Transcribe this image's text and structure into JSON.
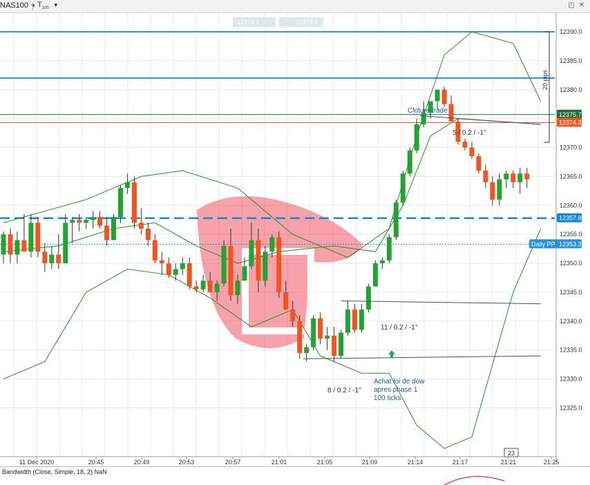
{
  "toolbar": {
    "symbol": "NAS100",
    "timeframe": "T",
    "timeframe_sub": "100",
    "icons": [
      "chevron-down-icon",
      "maximize-icon",
      "close-icon"
    ]
  },
  "crosshair_labels": {
    "left": "12374.x",
    "right": "12375.x"
  },
  "price_axis": {
    "ticks": [
      "12390.0",
      "12385.0",
      "12380.0",
      "12375.0",
      "12370.0",
      "12365.0",
      "12360.0",
      "12355.0",
      "12350.0",
      "12345.0",
      "12340.0",
      "12335.0",
      "12330.0",
      "12325.0"
    ],
    "tags": {
      "ask": "12375.7",
      "bid": "12374.3",
      "pivot": "12357.8",
      "daily_pp_name": "Daily PP",
      "daily_pp": "12353.3"
    },
    "pips_label": "20 pips"
  },
  "time_axis": {
    "ticks": [
      "11 Dec 2020",
      "20:45",
      "20:49",
      "20:53",
      "20:57",
      "21:01",
      "21:05",
      "21:09",
      "21:14",
      "21:17",
      "21:21",
      "21:25"
    ],
    "marker": "23"
  },
  "annotations": {
    "cloture": "Cloture trade",
    "ratio_top": "5 / 0.2 / -1°",
    "ratio_mid": "11 / 0.2 / -1°",
    "ratio_bottom": "8 / 0.2 / -1°",
    "achat_line1": "Achat loi de dow",
    "achat_line2": "apres phase 1",
    "achat_line3": "100 ticks"
  },
  "indicator": {
    "label": "Bandwidth (Close, Simple, 18, 2) NaN"
  },
  "colors": {
    "bull": "#22a333",
    "bear": "#ee5522",
    "bollinger": "#2a8a2a",
    "hline": "#1188dd",
    "ask": "#1e6e2e",
    "bid": "#ee5522",
    "pivot": "#1188dd",
    "annotation_text": "#1a5c8c"
  },
  "chart_data": {
    "type": "candlestick",
    "symbol": "NAS100",
    "y_range": [
      12322,
      12393
    ],
    "bollinger_bands": {
      "period": 18,
      "deviations": 2
    },
    "candles": [
      {
        "o": 12351.5,
        "h": 12355.5,
        "l": 12350.0,
        "c": 12355.0
      },
      {
        "o": 12355.0,
        "h": 12356.0,
        "l": 12350.0,
        "c": 12351.5
      },
      {
        "o": 12351.5,
        "h": 12355.5,
        "l": 12350.0,
        "c": 12354.0
      },
      {
        "o": 12354.0,
        "h": 12358.5,
        "l": 12352.0,
        "c": 12352.0
      },
      {
        "o": 12352.0,
        "h": 12358.5,
        "l": 12351.0,
        "c": 12357.0
      },
      {
        "o": 12357.0,
        "h": 12358.0,
        "l": 12351.0,
        "c": 12352.0
      },
      {
        "o": 12352.0,
        "h": 12353.5,
        "l": 12348.5,
        "c": 12350.0
      },
      {
        "o": 12350.0,
        "h": 12353.0,
        "l": 12349.0,
        "c": 12351.5
      },
      {
        "o": 12351.5,
        "h": 12355.0,
        "l": 12349.0,
        "c": 12350.0
      },
      {
        "o": 12350.0,
        "h": 12358.5,
        "l": 12350.0,
        "c": 12357.0
      },
      {
        "o": 12357.0,
        "h": 12358.0,
        "l": 12353.5,
        "c": 12357.5
      },
      {
        "o": 12357.5,
        "h": 12358.5,
        "l": 12355.5,
        "c": 12357.0
      },
      {
        "o": 12357.0,
        "h": 12358.0,
        "l": 12356.0,
        "c": 12357.5
      },
      {
        "o": 12357.5,
        "h": 12359.0,
        "l": 12356.0,
        "c": 12358.0
      },
      {
        "o": 12358.0,
        "h": 12359.0,
        "l": 12356.0,
        "c": 12356.5
      },
      {
        "o": 12356.5,
        "h": 12358.0,
        "l": 12353.0,
        "c": 12354.0
      },
      {
        "o": 12354.0,
        "h": 12358.5,
        "l": 12354.0,
        "c": 12358.0
      },
      {
        "o": 12358.0,
        "h": 12363.5,
        "l": 12357.0,
        "c": 12363.0
      },
      {
        "o": 12363.0,
        "h": 12365.5,
        "l": 12362.0,
        "c": 12364.0
      },
      {
        "o": 12364.0,
        "h": 12365.0,
        "l": 12356.0,
        "c": 12357.0
      },
      {
        "o": 12357.0,
        "h": 12359.5,
        "l": 12355.0,
        "c": 12356.0
      },
      {
        "o": 12356.0,
        "h": 12357.0,
        "l": 12353.0,
        "c": 12354.0
      },
      {
        "o": 12354.0,
        "h": 12355.0,
        "l": 12350.0,
        "c": 12350.5
      },
      {
        "o": 12350.5,
        "h": 12352.0,
        "l": 12348.0,
        "c": 12350.0
      },
      {
        "o": 12350.0,
        "h": 12351.0,
        "l": 12347.5,
        "c": 12348.0
      },
      {
        "o": 12348.0,
        "h": 12350.0,
        "l": 12347.0,
        "c": 12349.0
      },
      {
        "o": 12349.0,
        "h": 12351.0,
        "l": 12348.0,
        "c": 12350.0
      },
      {
        "o": 12350.0,
        "h": 12351.0,
        "l": 12345.5,
        "c": 12346.0
      },
      {
        "o": 12346.0,
        "h": 12347.0,
        "l": 12345.0,
        "c": 12345.5
      },
      {
        "o": 12345.5,
        "h": 12348.0,
        "l": 12345.0,
        "c": 12347.0
      },
      {
        "o": 12347.0,
        "h": 12348.5,
        "l": 12346.0,
        "c": 12345.0
      },
      {
        "o": 12345.0,
        "h": 12347.0,
        "l": 12343.5,
        "c": 12346.5
      },
      {
        "o": 12346.5,
        "h": 12354.0,
        "l": 12346.0,
        "c": 12353.0
      },
      {
        "o": 12353.0,
        "h": 12356.0,
        "l": 12343.5,
        "c": 12344.5
      },
      {
        "o": 12344.5,
        "h": 12348.0,
        "l": 12343.0,
        "c": 12347.0
      },
      {
        "o": 12347.0,
        "h": 12351.0,
        "l": 12347.0,
        "c": 12349.5
      },
      {
        "o": 12349.5,
        "h": 12357.0,
        "l": 12349.0,
        "c": 12354.0
      },
      {
        "o": 12354.0,
        "h": 12356.0,
        "l": 12345.0,
        "c": 12347.0
      },
      {
        "o": 12347.0,
        "h": 12353.0,
        "l": 12346.0,
        "c": 12352.0
      },
      {
        "o": 12352.0,
        "h": 12355.0,
        "l": 12351.0,
        "c": 12354.5
      },
      {
        "o": 12354.5,
        "h": 12355.5,
        "l": 12344.0,
        "c": 12345.0
      },
      {
        "o": 12345.0,
        "h": 12347.0,
        "l": 12342.0,
        "c": 12342.0
      },
      {
        "o": 12342.0,
        "h": 12343.5,
        "l": 12339.0,
        "c": 12340.0
      },
      {
        "o": 12340.0,
        "h": 12341.0,
        "l": 12333.5,
        "c": 12334.5
      },
      {
        "o": 12334.5,
        "h": 12336.0,
        "l": 12333.0,
        "c": 12335.5
      },
      {
        "o": 12335.5,
        "h": 12341.0,
        "l": 12335.0,
        "c": 12340.5
      },
      {
        "o": 12340.5,
        "h": 12341.5,
        "l": 12336.0,
        "c": 12337.0
      },
      {
        "o": 12337.0,
        "h": 12339.0,
        "l": 12335.0,
        "c": 12337.5
      },
      {
        "o": 12337.5,
        "h": 12339.0,
        "l": 12333.0,
        "c": 12334.0
      },
      {
        "o": 12334.0,
        "h": 12338.5,
        "l": 12333.5,
        "c": 12338.0
      },
      {
        "o": 12338.0,
        "h": 12343.5,
        "l": 12337.5,
        "c": 12342.0
      },
      {
        "o": 12342.0,
        "h": 12343.0,
        "l": 12338.0,
        "c": 12338.5
      },
      {
        "o": 12338.5,
        "h": 12343.0,
        "l": 12338.0,
        "c": 12342.0
      },
      {
        "o": 12342.0,
        "h": 12346.5,
        "l": 12341.5,
        "c": 12346.0
      },
      {
        "o": 12346.0,
        "h": 12350.5,
        "l": 12346.0,
        "c": 12350.0
      },
      {
        "o": 12350.0,
        "h": 12351.0,
        "l": 12349.0,
        "c": 12350.5
      },
      {
        "o": 12350.5,
        "h": 12355.0,
        "l": 12350.0,
        "c": 12354.5
      },
      {
        "o": 12354.5,
        "h": 12361.0,
        "l": 12354.0,
        "c": 12360.5
      },
      {
        "o": 12360.5,
        "h": 12366.0,
        "l": 12360.0,
        "c": 12365.5
      },
      {
        "o": 12365.5,
        "h": 12370.0,
        "l": 12365.0,
        "c": 12369.5
      },
      {
        "o": 12369.5,
        "h": 12375.0,
        "l": 12369.0,
        "c": 12374.0
      },
      {
        "o": 12374.0,
        "h": 12378.0,
        "l": 12373.5,
        "c": 12376.0
      },
      {
        "o": 12376.0,
        "h": 12378.0,
        "l": 12375.0,
        "c": 12378.0
      },
      {
        "o": 12378.0,
        "h": 12380.0,
        "l": 12376.5,
        "c": 12380.0
      },
      {
        "o": 12380.0,
        "h": 12380.5,
        "l": 12377.0,
        "c": 12377.5
      },
      {
        "o": 12377.5,
        "h": 12379.0,
        "l": 12376.0,
        "c": 12374.5
      },
      {
        "o": 12374.5,
        "h": 12375.0,
        "l": 12370.5,
        "c": 12371.0
      },
      {
        "o": 12371.0,
        "h": 12371.5,
        "l": 12369.5,
        "c": 12370.0
      },
      {
        "o": 12370.0,
        "h": 12371.0,
        "l": 12368.0,
        "c": 12368.5
      },
      {
        "o": 12368.5,
        "h": 12369.0,
        "l": 12365.5,
        "c": 12366.0
      },
      {
        "o": 12366.0,
        "h": 12367.0,
        "l": 12363.0,
        "c": 12364.0
      },
      {
        "o": 12364.0,
        "h": 12365.0,
        "l": 12360.0,
        "c": 12361.0
      },
      {
        "o": 12361.0,
        "h": 12365.5,
        "l": 12360.0,
        "c": 12364.5
      },
      {
        "o": 12364.5,
        "h": 12366.0,
        "l": 12363.0,
        "c": 12365.5
      },
      {
        "o": 12365.5,
        "h": 12366.0,
        "l": 12363.0,
        "c": 12364.0
      },
      {
        "o": 12364.0,
        "h": 12366.5,
        "l": 12362.0,
        "c": 12365.5
      },
      {
        "o": 12365.5,
        "h": 12366.5,
        "l": 12363.0,
        "c": 12364.5
      }
    ],
    "horizontal_levels": [
      12390.0,
      12382.0,
      12375.7,
      12374.3,
      12357.8,
      12353.3
    ],
    "bb_upper": [
      [
        0,
        12357
      ],
      [
        6,
        12359
      ],
      [
        12,
        12361
      ],
      [
        20,
        12365
      ],
      [
        26,
        12366
      ],
      [
        34,
        12363
      ],
      [
        42,
        12355
      ],
      [
        50,
        12351
      ],
      [
        56,
        12356
      ],
      [
        60,
        12372
      ],
      [
        64,
        12386
      ],
      [
        68,
        12390
      ],
      [
        74,
        12388
      ],
      [
        78,
        12378
      ]
    ],
    "bb_middle": [
      [
        0,
        12352
      ],
      [
        8,
        12353
      ],
      [
        16,
        12356
      ],
      [
        22,
        12357
      ],
      [
        28,
        12353
      ],
      [
        34,
        12350
      ],
      [
        40,
        12352
      ],
      [
        48,
        12353
      ],
      [
        54,
        12352
      ],
      [
        58,
        12360
      ],
      [
        62,
        12372
      ],
      [
        66,
        12375
      ],
      [
        78,
        12374
      ]
    ],
    "bb_lower": [
      [
        0,
        12330
      ],
      [
        6,
        12333
      ],
      [
        12,
        12345
      ],
      [
        18,
        12349
      ],
      [
        24,
        12348
      ],
      [
        30,
        12344
      ],
      [
        36,
        12339
      ],
      [
        42,
        12342
      ],
      [
        46,
        12334
      ],
      [
        52,
        12331
      ],
      [
        56,
        12331
      ],
      [
        60,
        12322
      ],
      [
        64,
        12318
      ],
      [
        68,
        12320
      ],
      [
        74,
        12345
      ],
      [
        78,
        12356
      ]
    ],
    "trendlines": [
      [
        [
          43.5,
          12333.5
        ],
        [
          78,
          12334
        ]
      ],
      [
        [
          49,
          12343.5
        ],
        [
          78,
          12343
        ]
      ],
      [
        [
          60.5,
          12375.5
        ],
        [
          78,
          12374
        ]
      ]
    ]
  }
}
